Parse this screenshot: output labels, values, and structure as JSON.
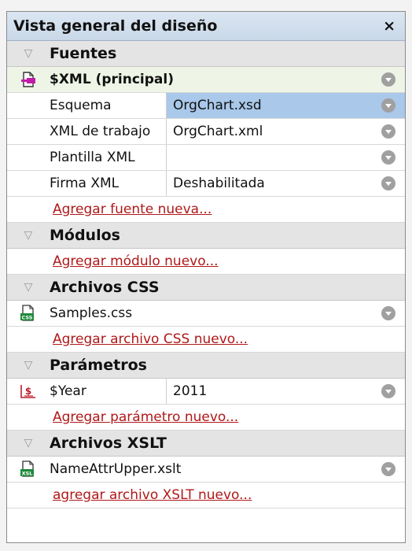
{
  "panel": {
    "title": "Vista general del diseño",
    "close_glyph": "×"
  },
  "sections": {
    "fuentes": {
      "header": "Fuentes",
      "source": {
        "name": "$XML (principal)",
        "icon": "xml-source-icon"
      },
      "props": [
        {
          "label": "Esquema",
          "value": "OrgChart.xsd"
        },
        {
          "label": "XML de trabajo",
          "value": "OrgChart.xml"
        },
        {
          "label": "Plantilla XML",
          "value": ""
        },
        {
          "label": "Firma XML",
          "value": "Deshabilitada"
        }
      ],
      "add_link": "Agregar fuente nueva..."
    },
    "modulos": {
      "header": "Módulos",
      "add_link": "Agregar módulo nuevo..."
    },
    "css": {
      "header": "Archivos CSS",
      "items": [
        {
          "name": "Samples.css",
          "icon": "css-file-icon"
        }
      ],
      "add_link": "Agregar archivo CSS nuevo..."
    },
    "parametros": {
      "header": "Parámetros",
      "items": [
        {
          "name": "$Year",
          "value": "2011",
          "icon": "parameter-icon"
        }
      ],
      "add_link": "Agregar parámetro nuevo..."
    },
    "xslt": {
      "header": "Archivos XSLT",
      "items": [
        {
          "name": "NameAttrUpper.xslt",
          "icon": "xslt-file-icon"
        }
      ],
      "add_link": "agregar archivo XSLT nuevo..."
    }
  },
  "colors": {
    "accent_link": "#b01818",
    "selection": "#a9c8ea",
    "source_row": "#eef5e6"
  }
}
